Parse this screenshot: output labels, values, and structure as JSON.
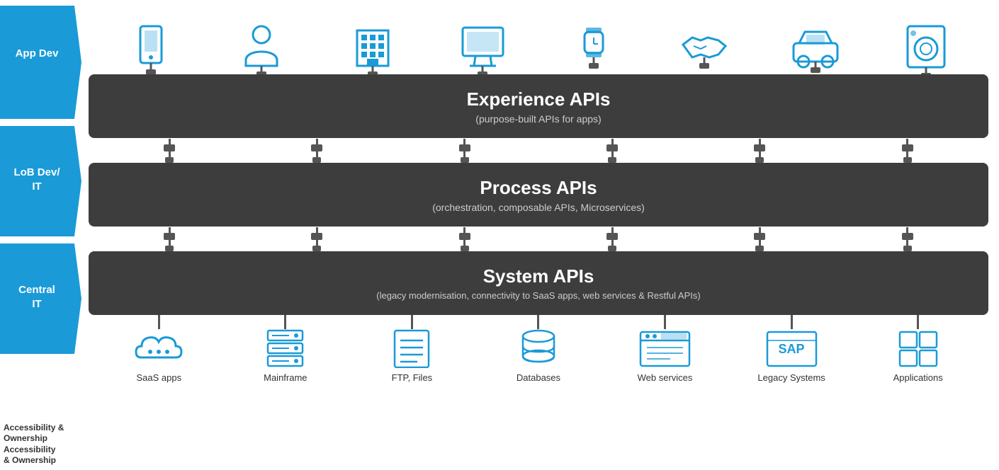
{
  "sidebar": {
    "chevrons": [
      {
        "label": "App Dev",
        "color": "#1a9ad7"
      },
      {
        "label": "LoB Dev/ IT",
        "color": "#1a9ad7"
      },
      {
        "label": "Central IT",
        "color": "#1a9ad7"
      }
    ],
    "accessibility_label": "Accessibility\n& Ownership"
  },
  "top_icons": [
    {
      "name": "mobile-icon",
      "label": "mobile"
    },
    {
      "name": "person-icon",
      "label": "person"
    },
    {
      "name": "building-icon",
      "label": "building"
    },
    {
      "name": "monitor-icon",
      "label": "monitor"
    },
    {
      "name": "watch-icon",
      "label": "watch"
    },
    {
      "name": "handshake-icon",
      "label": "handshake"
    },
    {
      "name": "car-icon",
      "label": "car"
    },
    {
      "name": "appliance-icon",
      "label": "appliance"
    }
  ],
  "api_layers": [
    {
      "id": "experience",
      "title": "Experience APIs",
      "subtitle": "(purpose-built APIs for apps)"
    },
    {
      "id": "process",
      "title": "Process APIs",
      "subtitle": "(orchestration, composable APIs, Microservices)"
    },
    {
      "id": "system",
      "title": "System APIs",
      "subtitle": "(legacy modernisation, connectivity to SaaS apps, web services & Restful APIs)"
    }
  ],
  "bottom_icons": [
    {
      "name": "saas-icon",
      "label": "SaaS apps"
    },
    {
      "name": "mainframe-icon",
      "label": "Mainframe"
    },
    {
      "name": "ftp-icon",
      "label": "FTP, Files"
    },
    {
      "name": "database-icon",
      "label": "Databases"
    },
    {
      "name": "webservices-icon",
      "label": "Web services"
    },
    {
      "name": "legacy-icon",
      "label": "Legacy Systems"
    },
    {
      "name": "applications-icon",
      "label": "Applications"
    }
  ],
  "colors": {
    "blue": "#1a9ad7",
    "dark_bg": "#3d3d3d",
    "connector": "#555555",
    "text_light": "#ffffff",
    "text_dark": "#333333",
    "subtitle": "#cccccc"
  }
}
